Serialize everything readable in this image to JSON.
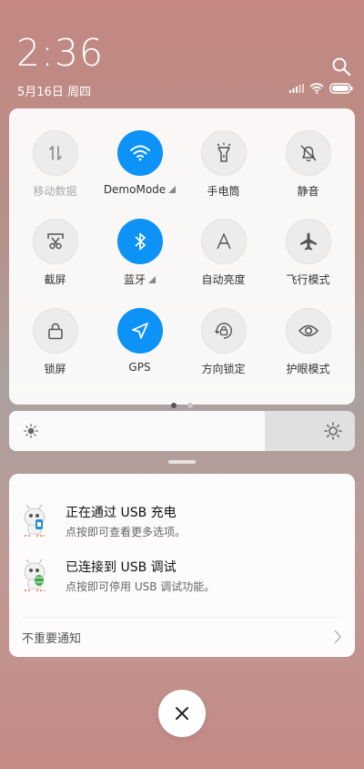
{
  "status": {
    "time": "2:36",
    "date": "5月16日 周四"
  },
  "quick_settings": {
    "tiles": [
      {
        "label": "移动数据",
        "icon": "mobile-data-icon",
        "active": false,
        "disabled": true
      },
      {
        "label": "DemoMode",
        "icon": "wifi-icon",
        "active": true,
        "has_more": true
      },
      {
        "label": "手电筒",
        "icon": "flashlight-icon",
        "active": false
      },
      {
        "label": "静音",
        "icon": "mute-icon",
        "active": false
      },
      {
        "label": "截屏",
        "icon": "screenshot-icon",
        "active": false
      },
      {
        "label": "蓝牙",
        "icon": "bluetooth-icon",
        "active": true,
        "has_more": true
      },
      {
        "label": "自动亮度",
        "icon": "auto-brightness-icon",
        "active": false
      },
      {
        "label": "飞行模式",
        "icon": "airplane-icon",
        "active": false
      },
      {
        "label": "锁屏",
        "icon": "lock-icon",
        "active": false
      },
      {
        "label": "GPS",
        "icon": "gps-icon",
        "active": true
      },
      {
        "label": "方向锁定",
        "icon": "rotation-lock-icon",
        "active": false
      },
      {
        "label": "护眼模式",
        "icon": "eye-icon",
        "active": false
      }
    ],
    "pages": 2,
    "current_page": 1
  },
  "brightness": {
    "level": 0.74
  },
  "notifications": [
    {
      "title": "正在通过 USB 充电",
      "subtitle": "点按即可查看更多选项。",
      "icon": "android-debug-icon"
    },
    {
      "title": "已连接到 USB 调试",
      "subtitle": "点按即可停用 USB 调试功能。",
      "icon": "android-debug-icon"
    }
  ],
  "unimportant_label": "不重要通知",
  "colors": {
    "accent": "#0d92f7"
  }
}
